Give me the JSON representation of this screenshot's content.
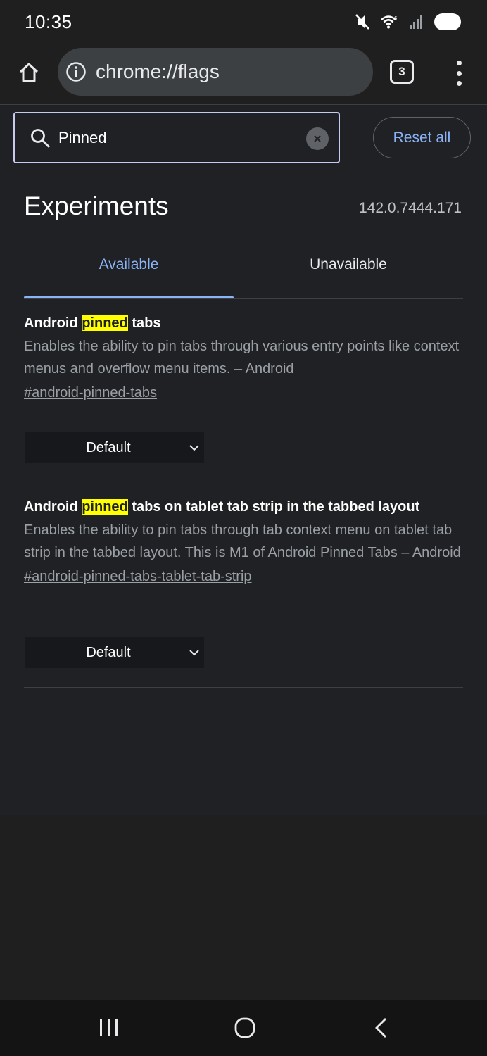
{
  "status_bar": {
    "time": "10:35",
    "icons": [
      "mute-icon",
      "wifi-icon",
      "signal-icon",
      "battery-icon"
    ]
  },
  "toolbar": {
    "url": "chrome://flags",
    "tab_count": "3"
  },
  "search": {
    "value": "Pinned",
    "reset_label": "Reset all"
  },
  "header": {
    "title": "Experiments",
    "version": "142.0.7444.171"
  },
  "tabs": [
    {
      "label": "Available",
      "selected": true
    },
    {
      "label": "Unavailable",
      "selected": false
    }
  ],
  "experiments": [
    {
      "title_before": "Android ",
      "title_highlight": "pinned",
      "title_after": " tabs",
      "description": "Enables the ability to pin tabs through various entry points like context menus and overflow menu items. – Android",
      "link": "#android-pinned-tabs",
      "select_value": "Default"
    },
    {
      "title_before": "Android ",
      "title_highlight": "pinned",
      "title_after": " tabs on tablet tab strip in the tabbed layout",
      "description": "Enables the ability to pin tabs through tab context menu on tablet tab strip in the tabbed layout. This is M1 of Android Pinned Tabs – Android",
      "link": "#android-pinned-tabs-tablet-tab-strip",
      "select_value": "Default"
    }
  ],
  "colors": {
    "accent": "#8ab4f8",
    "highlight": "#ffff00",
    "background": "#202124"
  }
}
